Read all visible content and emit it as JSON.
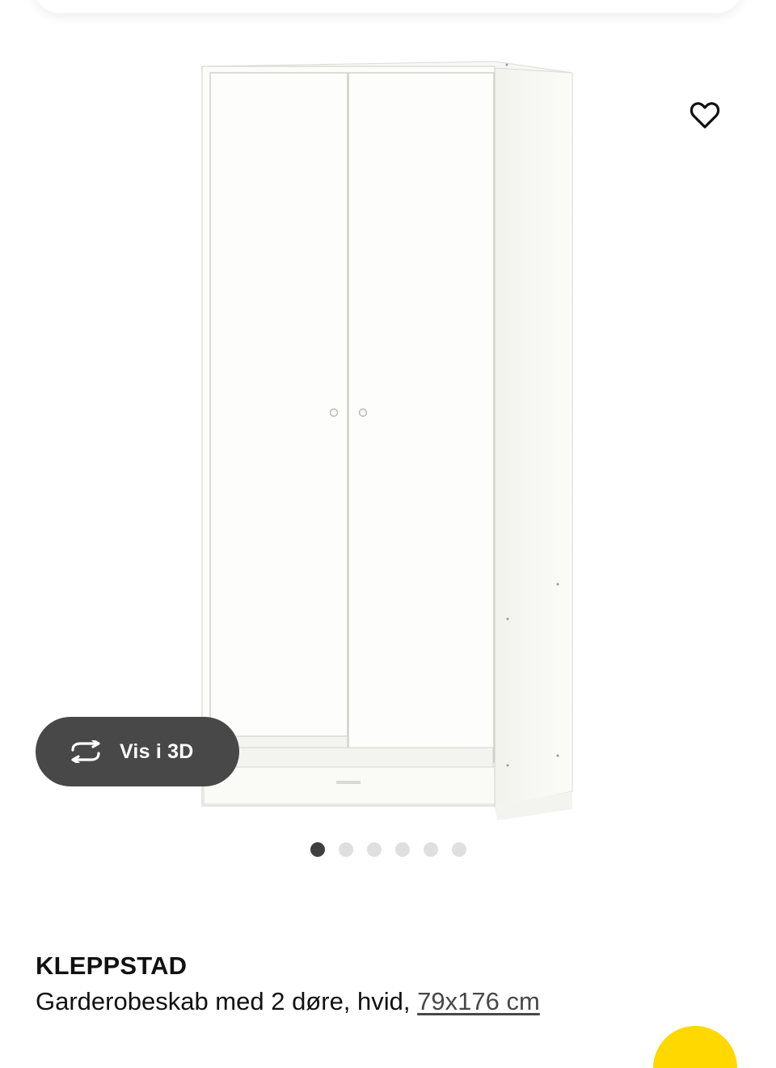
{
  "gallery": {
    "image_alt": "wardrobe-image",
    "favorite_icon": "heart-outline-icon",
    "view_3d": {
      "icon": "rotate-3d-icon",
      "label": "Vis i 3D"
    },
    "dots": {
      "count": 6,
      "active_index": 0
    }
  },
  "product": {
    "name": "KLEPPSTAD",
    "description": "Garderobeskab med 2 døre, hvid, ",
    "size": "79x176 cm"
  },
  "colors": {
    "button_bg": "#484848",
    "active_dot": "#3f3f3f",
    "inactive_dot": "#dfdfdf",
    "accent_yellow": "#ffd800"
  }
}
